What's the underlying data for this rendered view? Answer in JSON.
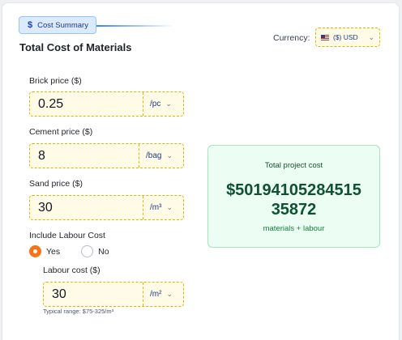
{
  "tab": {
    "icon": "$",
    "label": "Cost Summary"
  },
  "title": "Total Cost of Materials",
  "currency": {
    "label": "Currency:",
    "selected": "($) USD",
    "flag": "us-flag-icon"
  },
  "brick": {
    "label": "Brick price ($)",
    "value": "0.25",
    "unit": "/pc"
  },
  "cement": {
    "label": "Cement price ($)",
    "value": "8",
    "unit": "/bag"
  },
  "sand": {
    "label": "Sand price ($)",
    "value": "30",
    "unit": "/m³"
  },
  "labour_toggle": {
    "label": "Include Labour Cost",
    "yes": "Yes",
    "no": "No",
    "selected": "Yes"
  },
  "labour": {
    "label": "Labour cost ($)",
    "value": "30",
    "unit": "/m²",
    "hint": "Typical range: $75-325/m³"
  },
  "result": {
    "title": "Total project cost",
    "value": "$5019410528451535872",
    "subtitle": "materials + labour"
  },
  "colors": {
    "accent": "#f97316",
    "field_bg": "#fffbe6",
    "field_border": "#e5b400",
    "result_bg": "#ecfdf3",
    "result_text": "#0f5132"
  }
}
